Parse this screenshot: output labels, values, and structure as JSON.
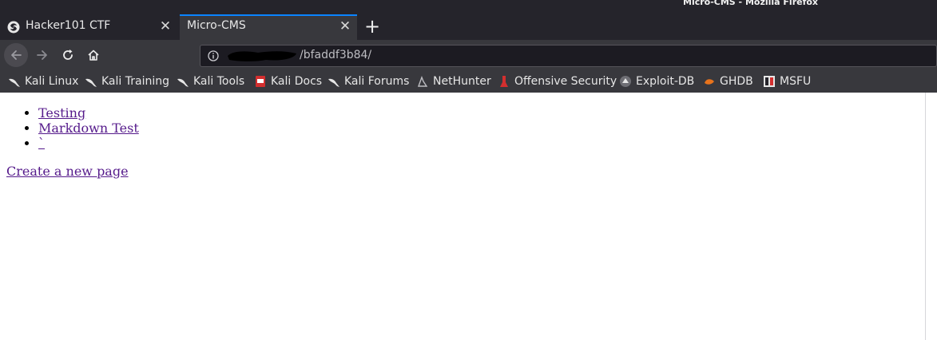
{
  "window": {
    "title": "Micro-CMS - Mozilla Firefox"
  },
  "tabs": [
    {
      "title": "Hacker101 CTF",
      "active": false
    },
    {
      "title": "Micro-CMS",
      "active": true
    }
  ],
  "navbar": {
    "url_visible": "/bfaddf3b84/"
  },
  "bookmarks": [
    {
      "label": "Kali Linux",
      "icon": "kali-dragon-icon"
    },
    {
      "label": "Kali Training",
      "icon": "kali-dragon-icon"
    },
    {
      "label": "Kali Tools",
      "icon": "kali-dragon-icon"
    },
    {
      "label": "Kali Docs",
      "icon": "kali-docs-icon"
    },
    {
      "label": "Kali Forums",
      "icon": "kali-dragon-icon"
    },
    {
      "label": "NetHunter",
      "icon": "nethunter-icon"
    },
    {
      "label": "Offensive Security",
      "icon": "offsec-icon"
    },
    {
      "label": "Exploit-DB",
      "icon": "exploitdb-icon"
    },
    {
      "label": "GHDB",
      "icon": "ghdb-icon"
    },
    {
      "label": "MSFU",
      "icon": "msfu-icon"
    }
  ],
  "page": {
    "pages": [
      {
        "label": "Testing"
      },
      {
        "label": "Markdown Test"
      },
      {
        "label": "`"
      }
    ],
    "create_label": "Create a new page"
  },
  "colors": {
    "chrome_dark": "#25242b",
    "toolbar": "#38383d",
    "accent": "#0a84ff",
    "visited_link": "#551a8b"
  }
}
